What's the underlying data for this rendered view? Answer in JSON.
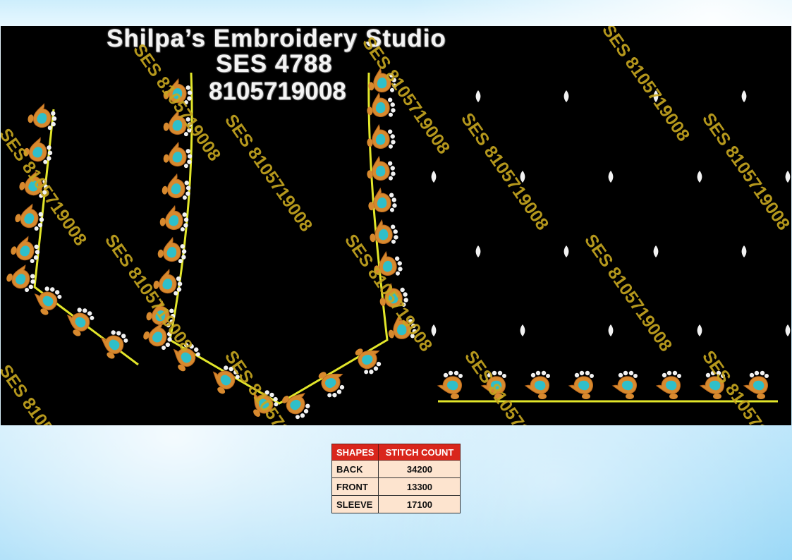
{
  "header": {
    "studio_name": "Shilpa’s Embroidery Studio",
    "design_code": "SES 4788",
    "phone": "8105719008"
  },
  "watermark": {
    "text": "SES 8105719008"
  },
  "stitch_table": {
    "headers": [
      "SHAPES",
      "STITCH COUNT"
    ],
    "rows": [
      {
        "shape": "BACK",
        "count": "34200"
      },
      {
        "shape": "FRONT",
        "count": "13300"
      },
      {
        "shape": "SLEEVE",
        "count": "17100"
      }
    ]
  },
  "colors": {
    "panel_background": "#000000",
    "outline_yellow": "#e2e62a",
    "paisley_orange": "#d7892e",
    "paisley_turquoise": "#2fbfc9",
    "bead_white": "#f2f2f2",
    "watermark_gold": "#c8a820",
    "table_header_red": "#d9261c",
    "table_cell_peach": "#fde4cf"
  }
}
